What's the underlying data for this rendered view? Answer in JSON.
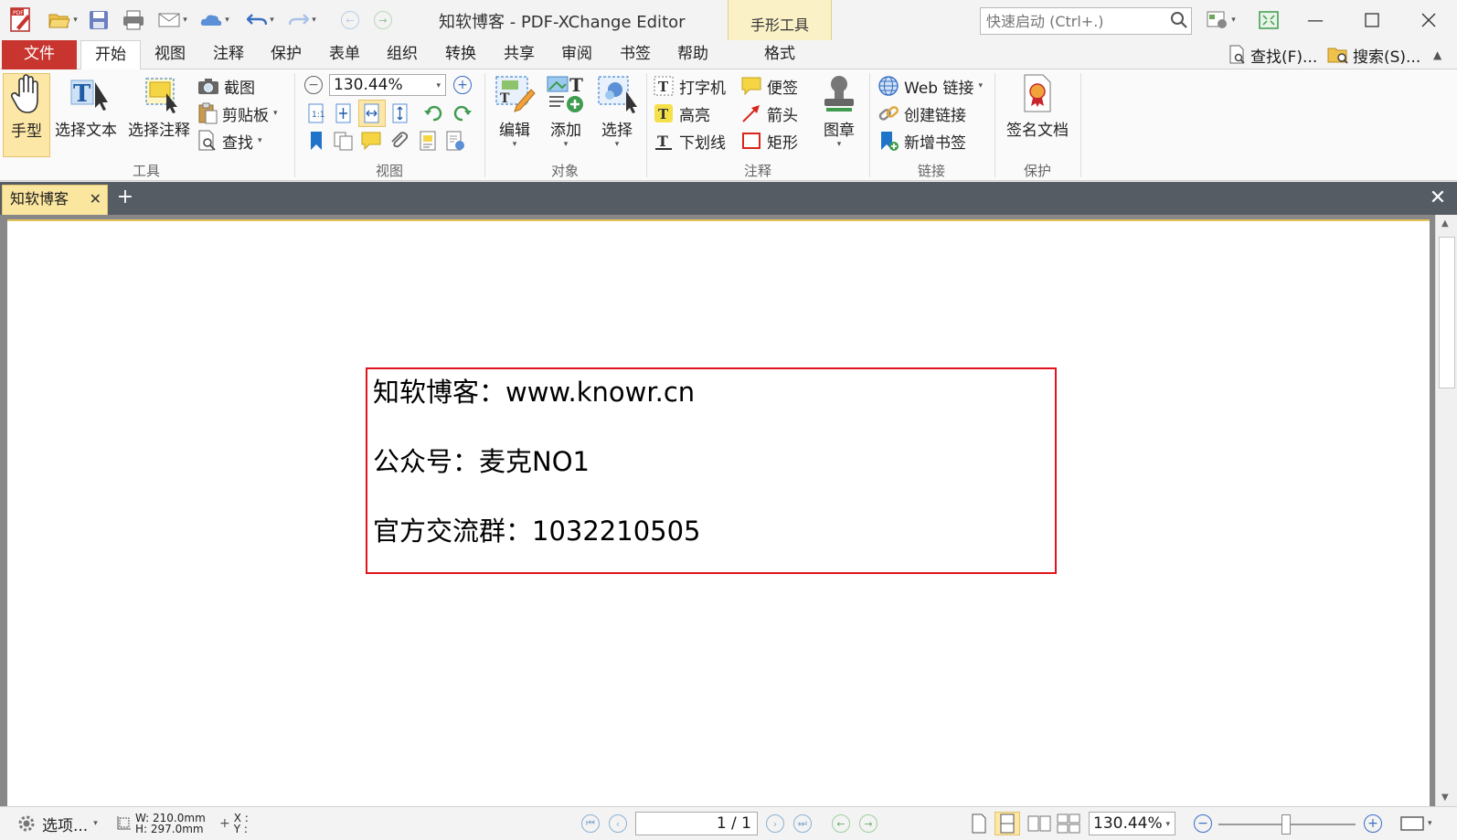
{
  "window": {
    "title": "知软博客 - PDF-XChange Editor",
    "context_tab_title": "手形工具",
    "quick_launch_placeholder": "快速启动 (Ctrl+.)"
  },
  "menu": {
    "file": "文件",
    "tabs": [
      "开始",
      "视图",
      "注释",
      "保护",
      "表单",
      "组织",
      "转换",
      "共享",
      "审阅",
      "书签",
      "帮助"
    ],
    "format": "格式",
    "find": "查找(F)...",
    "search": "搜索(S)..."
  },
  "ribbon": {
    "tools": {
      "group": "工具",
      "hand": "手型",
      "select_text": "选择文本",
      "select_annot": "选择注释",
      "snapshot": "截图",
      "clipboard": "剪贴板",
      "find": "查找"
    },
    "view": {
      "group": "视图",
      "zoom": "130.44%"
    },
    "objects": {
      "group": "对象",
      "edit": "编辑",
      "add": "添加",
      "select": "选择"
    },
    "comment": {
      "group": "注释",
      "typewriter": "打字机",
      "note": "便签",
      "highlight": "高亮",
      "arrow": "箭头",
      "underline": "下划线",
      "rectangle": "矩形",
      "stamp": "图章"
    },
    "links": {
      "group": "链接",
      "web_links": "Web 链接",
      "create_link": "创建链接",
      "add_bookmark": "新增书签"
    },
    "protect": {
      "group": "保护",
      "sign": "签名文档"
    }
  },
  "doc_tab": {
    "name": "知软博客"
  },
  "document": {
    "lines": [
      "知软博客：www.knowr.cn",
      "公众号：麦克NO1",
      "官方交流群：1032210505"
    ]
  },
  "status": {
    "options": "选项...",
    "width": "W: 210.0mm",
    "height": "H: 297.0mm",
    "x": "X :",
    "y": "Y :",
    "page": "1 / 1",
    "zoom": "130.44%"
  },
  "colors": {
    "file_tab": "#c8352f",
    "context_tab": "#fbf1c7",
    "doc_tab": "#fbe6a0",
    "text_box_border": "#e0141e"
  }
}
